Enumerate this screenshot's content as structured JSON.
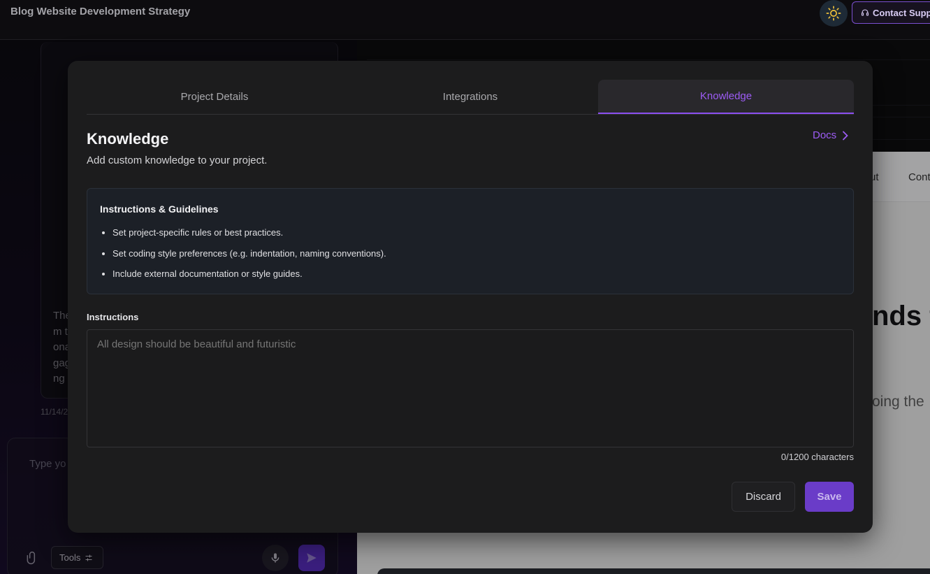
{
  "app": {
    "title": "Blog Website Development Strategy",
    "contact_support_label": "Contact Supp"
  },
  "chat": {
    "message_fragment": "The\nm t\nona\ngag\nng",
    "date_fragment": "11/14/2",
    "composer_placeholder": "Type yo",
    "tools_label": "Tools"
  },
  "preview": {
    "nav_links": [
      "ut",
      "Cont"
    ],
    "hero_fragment": "nds t",
    "hero_sub_fragment": "oing the"
  },
  "modal": {
    "tabs": [
      {
        "label": "Project Details",
        "active": false
      },
      {
        "label": "Integrations",
        "active": false
      },
      {
        "label": "Knowledge",
        "active": true
      }
    ],
    "title": "Knowledge",
    "subtitle": "Add custom knowledge to your project.",
    "docs_label": "Docs",
    "guidelines": {
      "title": "Instructions & Guidelines",
      "items": [
        "Set project-specific rules or best practices.",
        "Set coding style preferences (e.g. indentation, naming conventions).",
        "Include external documentation or style guides."
      ]
    },
    "instructions_label": "Instructions",
    "instructions_placeholder": "All design should be beautiful and futuristic",
    "char_count": "0/1200 characters",
    "discard_label": "Discard",
    "save_label": "Save"
  },
  "colors": {
    "accent": "#9d5cf5",
    "save_bg": "#6a3cc8",
    "modal_bg": "#1c1c1d"
  },
  "icons": {
    "theme": "sun-icon",
    "support": "headset-icon",
    "docs": "chevron-right-icon",
    "attach": "paperclip-icon",
    "tools": "sliders-icon",
    "mic": "microphone-icon",
    "send": "send-icon"
  }
}
